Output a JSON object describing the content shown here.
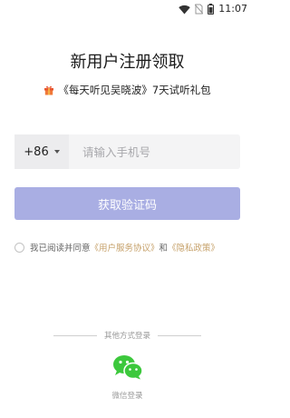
{
  "status_bar": {
    "time": "11:07"
  },
  "title": "新用户注册领取",
  "promo": {
    "text": "《每天听见吴晓波》7天试听礼包"
  },
  "phone": {
    "country_code": "+86",
    "placeholder": "请输入手机号",
    "value": ""
  },
  "get_code": {
    "label": "获取验证码",
    "color": "#a9aee3"
  },
  "agreement": {
    "prefix": "我已阅读并同意",
    "user_agreement": "《用户服务协议》",
    "and": "和",
    "privacy_policy": "《隐私政策》",
    "link_color": "#c6a16a"
  },
  "other_login": {
    "divider_text": "其他方式登录",
    "wechat_label": "微信登录",
    "wechat_color": "#3cc83c"
  }
}
